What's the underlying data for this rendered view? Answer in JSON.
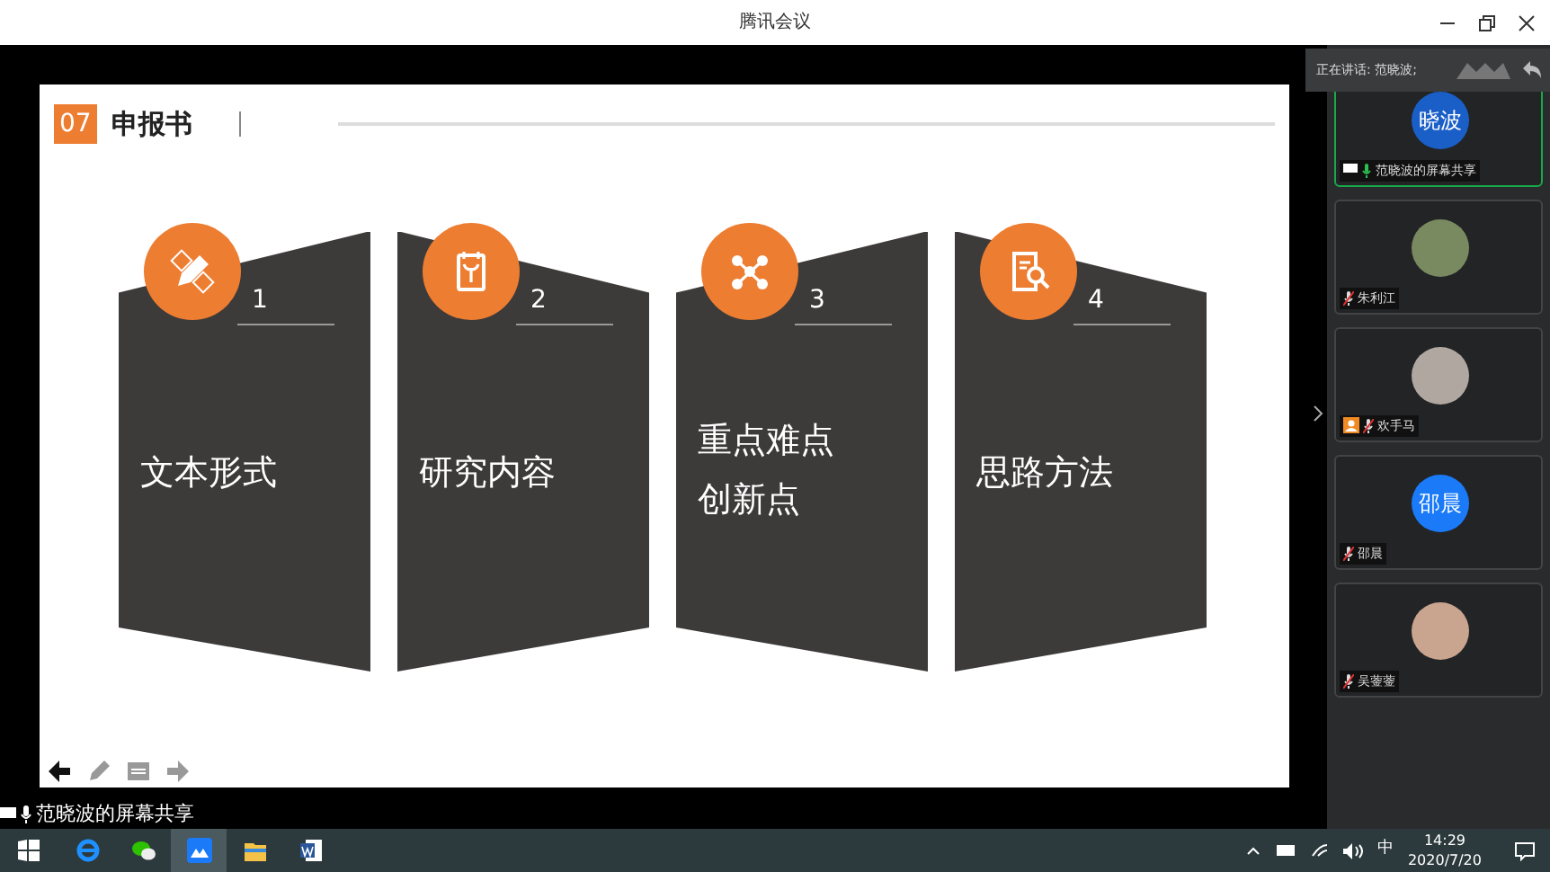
{
  "window": {
    "title": "腾讯会议"
  },
  "slide": {
    "number": "07",
    "title": "申报书",
    "cards": [
      {
        "number": "1",
        "lines": [
          "文本形式"
        ]
      },
      {
        "number": "2",
        "lines": [
          "研究内容"
        ]
      },
      {
        "number": "3",
        "lines": [
          "重点难点",
          "创新点"
        ]
      },
      {
        "number": "4",
        "lines": [
          "思路方法"
        ]
      }
    ]
  },
  "share_label": "范晓波的屏幕共享",
  "speaking": {
    "label": "正在讲话: 范晓波;"
  },
  "participants": [
    {
      "name": "范晓波的屏幕共享",
      "kind": "text",
      "avatar_text": "晓波",
      "active": true,
      "muted": false,
      "sharing": true,
      "host": false
    },
    {
      "name": "朱利江",
      "kind": "photo",
      "active": false,
      "muted": true,
      "sharing": false,
      "host": false
    },
    {
      "name": "欢手马",
      "kind": "photo",
      "active": false,
      "muted": true,
      "sharing": false,
      "host": true
    },
    {
      "name": "邵晨",
      "kind": "text",
      "avatar_text": "邵晨",
      "active": false,
      "muted": true,
      "sharing": false,
      "host": false
    },
    {
      "name": "吴蓥蓥",
      "kind": "photo",
      "active": false,
      "muted": true,
      "sharing": false,
      "host": false
    }
  ],
  "taskbar": {
    "apps": [
      {
        "selected": false
      },
      {
        "selected": false
      },
      {
        "selected": true
      },
      {
        "selected": false
      },
      {
        "selected": false
      }
    ],
    "ime": "中",
    "time": "14:29",
    "date": "2020/7/20"
  }
}
